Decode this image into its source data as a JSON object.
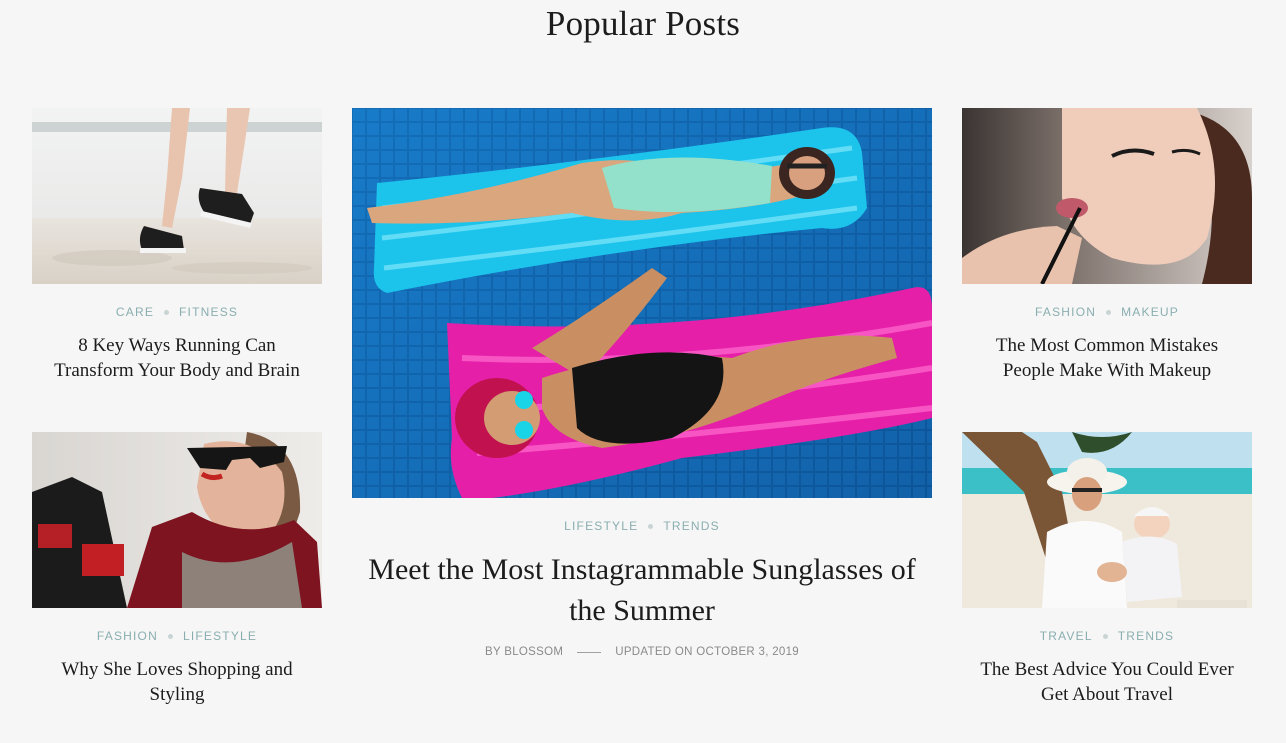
{
  "section_title": "Popular Posts",
  "posts": [
    {
      "categories": [
        "CARE",
        "FITNESS"
      ],
      "title": "8 Key Ways Running Can Transform Your Body and Brain",
      "image_icon": "running-shoes-beach-photo"
    },
    {
      "categories": [
        "FASHION",
        "LIFESTYLE"
      ],
      "title": "Why She Loves Shopping and Styling",
      "image_icon": "woman-sunglasses-photo"
    },
    {
      "categories": [
        "LIFESTYLE",
        "TRENDS"
      ],
      "title": "Meet the Most Instagrammable Sunglasses of the Summer",
      "author": "BY BLOSSOM",
      "updated": "UPDATED ON OCTOBER 3, 2019",
      "image_icon": "pool-floats-photo"
    },
    {
      "categories": [
        "FASHION",
        "MAKEUP"
      ],
      "title": "The Most Common Mistakes People Make With Makeup",
      "image_icon": "makeup-lipstick-photo"
    },
    {
      "categories": [
        "TRAVEL",
        "TRENDS"
      ],
      "title": "The Best Advice You Could Ever Get About Travel",
      "image_icon": "beach-mother-baby-photo"
    }
  ],
  "colors": {
    "background": "#f5f6f5",
    "category": "#8aaeb0",
    "title": "#1c1c1c",
    "meta": "#8a8a8a"
  }
}
